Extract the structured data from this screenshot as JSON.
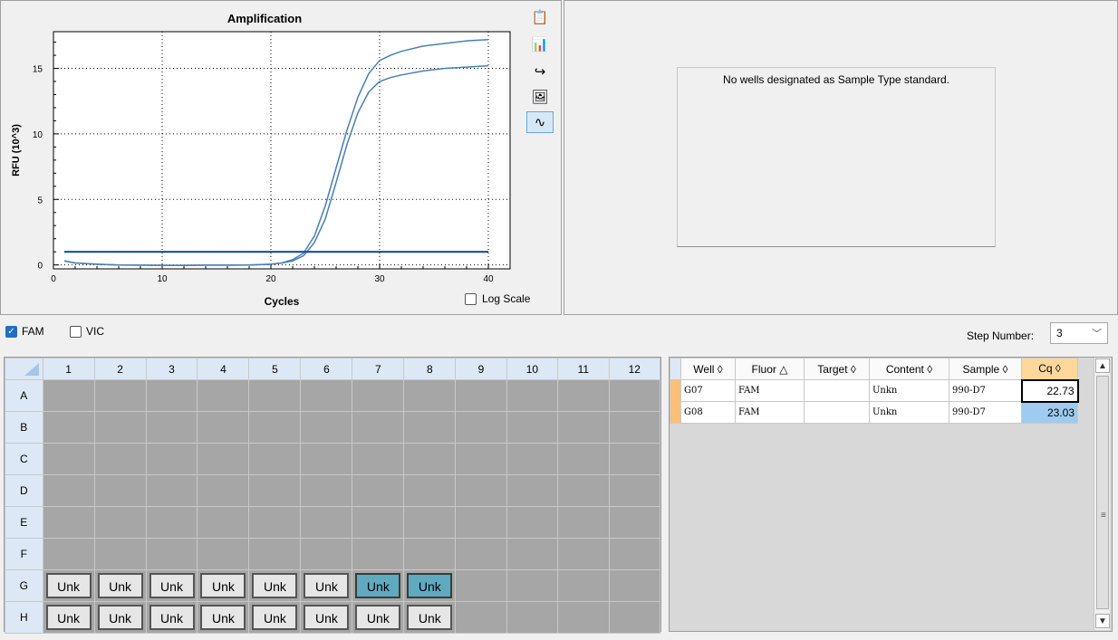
{
  "chart": {
    "title": "Amplification",
    "xlabel": "Cycles",
    "ylabel": "RFU (10^3)",
    "xticks": [
      "0",
      "10",
      "20",
      "30",
      "40"
    ],
    "yticks": [
      "0",
      "5",
      "10",
      "15"
    ],
    "log_scale_label": "Log Scale"
  },
  "chart_data": {
    "type": "line",
    "title": "Amplification",
    "xlabel": "Cycles",
    "ylabel": "RFU (10^3)",
    "xlim": [
      0,
      42
    ],
    "ylim": [
      -0.3,
      17.8
    ],
    "grid": true,
    "series": [
      {
        "color": "#4a7fb5",
        "x": [
          1,
          2,
          4,
          6,
          8,
          10,
          12,
          14,
          16,
          18,
          20,
          21,
          22,
          23,
          24,
          25,
          26,
          27,
          28,
          29,
          30,
          31,
          32,
          34,
          36,
          38,
          40
        ],
        "values": [
          0.3,
          0.15,
          0.05,
          0.0,
          -0.02,
          -0.03,
          -0.03,
          -0.02,
          -0.02,
          0.0,
          0.05,
          0.15,
          0.4,
          0.9,
          2.2,
          4.5,
          7.4,
          10.3,
          12.8,
          14.6,
          15.6,
          16.0,
          16.3,
          16.7,
          16.9,
          17.1,
          17.2
        ]
      },
      {
        "color": "#4a7fb5",
        "x": [
          1,
          2,
          4,
          6,
          8,
          10,
          12,
          14,
          16,
          18,
          20,
          21,
          22,
          23,
          24,
          25,
          26,
          27,
          28,
          29,
          30,
          31,
          32,
          34,
          36,
          38,
          40
        ],
        "values": [
          0.3,
          0.15,
          0.05,
          0.0,
          -0.02,
          -0.03,
          -0.03,
          -0.02,
          -0.02,
          0.0,
          0.05,
          0.15,
          0.3,
          0.7,
          1.7,
          3.5,
          6.3,
          9.2,
          11.6,
          13.2,
          14.0,
          14.3,
          14.5,
          14.8,
          15.0,
          15.1,
          15.2
        ]
      },
      {
        "color": "#1f4e86",
        "x": [
          1,
          40
        ],
        "values": [
          1.0,
          1.0
        ]
      }
    ]
  },
  "standard_curve": {
    "message": "No wells designated as Sample Type standard."
  },
  "fluors": [
    {
      "label": "FAM",
      "checked": true
    },
    {
      "label": "VIC",
      "checked": false
    }
  ],
  "step": {
    "label": "Step Number:",
    "value": "3"
  },
  "plate": {
    "columns": [
      "1",
      "2",
      "3",
      "4",
      "5",
      "6",
      "7",
      "8",
      "9",
      "10",
      "11",
      "12"
    ],
    "rows": [
      "A",
      "B",
      "C",
      "D",
      "E",
      "F",
      "G",
      "H"
    ],
    "well_label": "Unk"
  },
  "results": {
    "headers": [
      "Well",
      "Fluor",
      "Target",
      "Content",
      "Sample",
      "Cq"
    ],
    "rows": [
      {
        "well": "G07",
        "fluor": "FAM",
        "target": "",
        "content": "Unkn",
        "sample": "990-D7",
        "cq": "22.73"
      },
      {
        "well": "G08",
        "fluor": "FAM",
        "target": "",
        "content": "Unkn",
        "sample": "990-D7",
        "cq": "23.03"
      }
    ]
  },
  "colors": {
    "curve": "#4a7fb5",
    "threshold": "#1f4e86",
    "selected_well": "#60aabf",
    "cq_header": "#ffd79a",
    "row_marker": "#fbbf77"
  }
}
